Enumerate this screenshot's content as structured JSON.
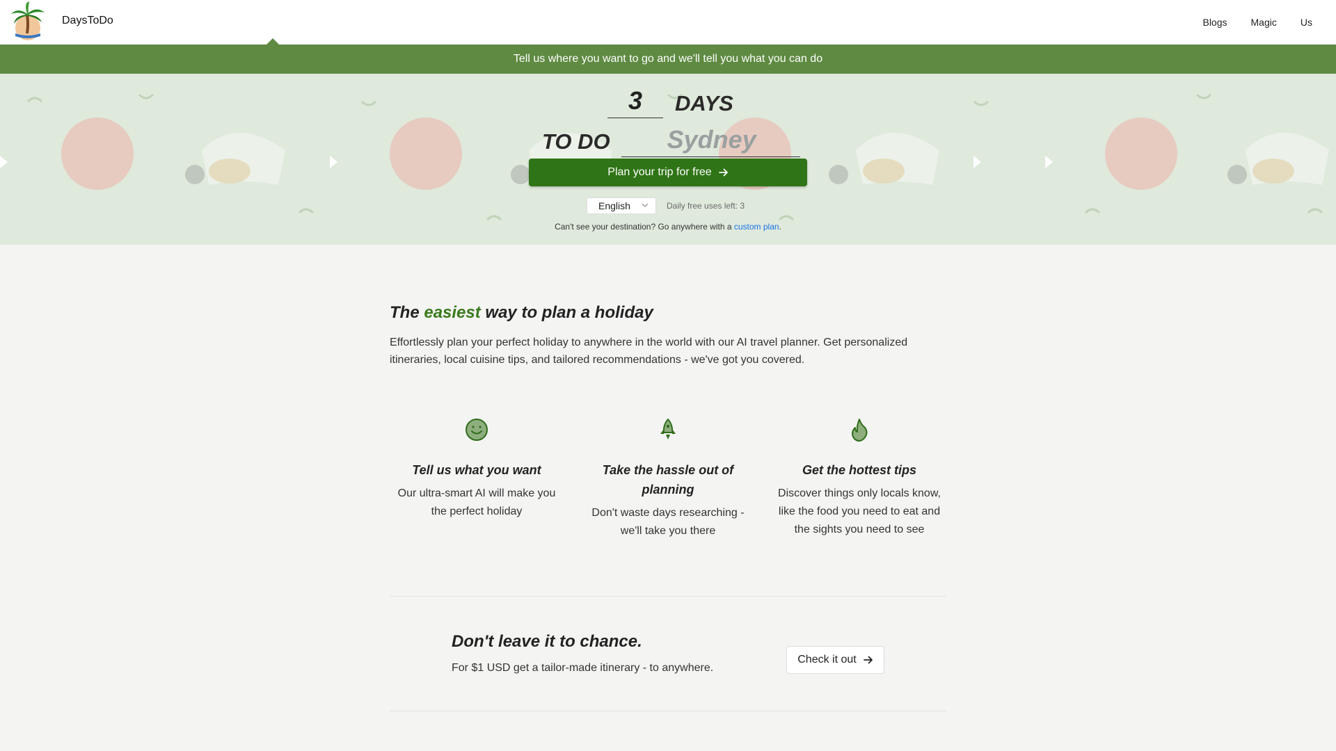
{
  "header": {
    "brand": "DaysToDo",
    "nav": [
      "Blogs",
      "Magic",
      "Us"
    ]
  },
  "banner": {
    "text": "Tell us where you want to go and we'll tell you what you can do"
  },
  "hero": {
    "days_value": "3",
    "days_label": "DAYS",
    "todo_label": "TO DO",
    "destination_placeholder": "Sydney",
    "plan_button": "Plan your trip for free",
    "language": "English",
    "uses_left": "Daily free uses left: 3",
    "custom_note_prefix": "Can't see your destination? Go anywhere with a ",
    "custom_link": "custom plan",
    "custom_note_suffix": "."
  },
  "intro": {
    "title_pre": "The ",
    "title_accent": "easiest",
    "title_post": " way to plan a holiday",
    "description": "Effortlessly plan your perfect holiday to anywhere in the world with our AI travel planner. Get personalized itineraries, local cuisine tips, and tailored recommendations - we've got you covered."
  },
  "features": [
    {
      "icon": "smile-icon",
      "title": "Tell us what you want",
      "text": "Our ultra-smart AI will make you the perfect holiday"
    },
    {
      "icon": "rocket-icon",
      "title": "Take the hassle out of planning",
      "text": "Don't waste days researching - we'll take you there"
    },
    {
      "icon": "flame-icon",
      "title": "Get the hottest tips",
      "text": "Discover things only locals know, like the food you need to eat and the sights you need to see"
    }
  ],
  "cta": {
    "title": "Don't leave it to chance.",
    "description": "For $1 USD get a tailor-made itinerary - to anywhere.",
    "button": "Check it out"
  },
  "colors": {
    "brand_green": "#5f8a42",
    "button_green": "#2f7416",
    "accent_green": "#3a7a1c",
    "link_blue": "#1a73e8"
  }
}
